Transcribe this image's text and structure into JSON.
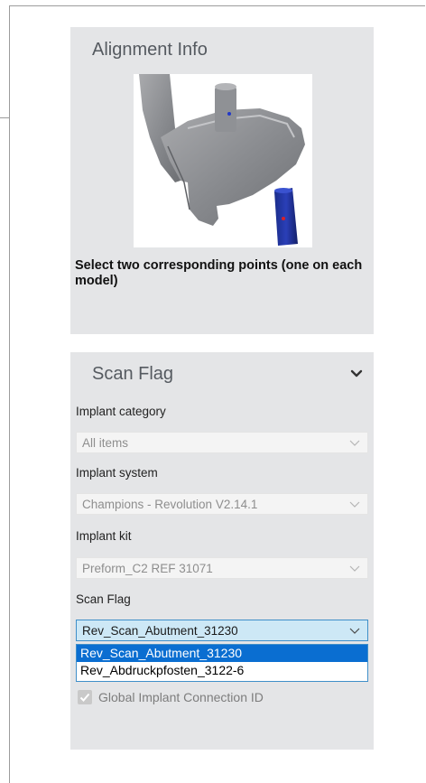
{
  "alignment": {
    "title": "Alignment Info",
    "instruction": "Select two corresponding points (one on each model)"
  },
  "scan_flag": {
    "title": "Scan Flag",
    "fields": [
      {
        "label": "Implant category",
        "value": "All items"
      },
      {
        "label": "Implant system",
        "value": "Champions - Revolution V2.14.1"
      },
      {
        "label": "Implant kit",
        "value": "Preform_C2 REF 31071"
      },
      {
        "label": "Scan Flag",
        "value": "Rev_Scan_Abutment_31230"
      }
    ],
    "dropdown_options": [
      "Rev_Scan_Abutment_31230",
      "Rev_Abdruckpfosten_3122-6"
    ],
    "global_connection_label": "Global Implant Connection ID"
  },
  "colors": {
    "panel_bg": "#e4e5e7",
    "highlight": "#0a6ed1",
    "active_select_bg": "#cde8f6",
    "active_select_border": "#3f8fc9"
  },
  "icons": [
    "chevron-down-icon",
    "model-3d-preview",
    "checkbox-checked"
  ]
}
